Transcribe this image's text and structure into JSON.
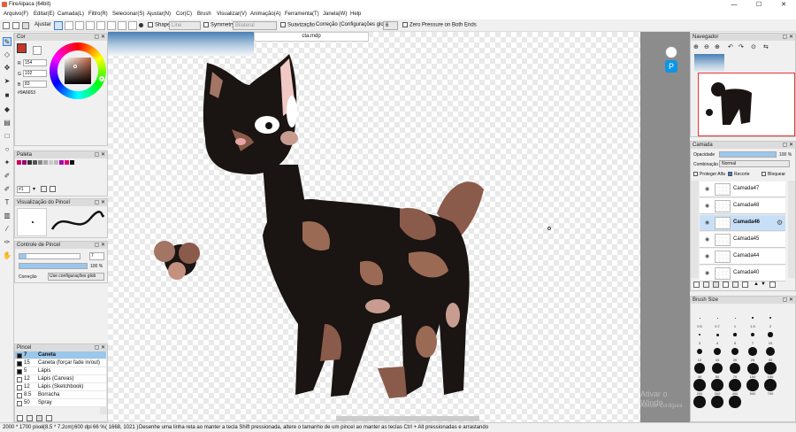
{
  "app": {
    "title": "FireAlpaca (64bit)",
    "window_controls": [
      "—",
      "☐",
      "✕"
    ]
  },
  "menu": [
    "Arquivo(F)",
    "Editar(E)",
    "Camada(L)",
    "Filtro(R)",
    "Selecionar(S)",
    "Ajustar(N)",
    "Cor(C)",
    "Brush",
    "Visualizar(V)",
    "Animação(A)",
    "Ferramenta(T)",
    "Janela(W)",
    "Help"
  ],
  "tool_options": {
    "ajustar": "Ajustar",
    "shape": "Shape",
    "shape_value": "Line",
    "symmetry": "Symmetry",
    "symmetry_value": "Bilateral",
    "suavizacao": "Suavização",
    "correcao": "Correção (Configurações globais)",
    "correcao_value": "6",
    "zero_pressure": "Zero Pressure on Both Ends"
  },
  "document_tab": "cta.mdp",
  "color_panel": {
    "title": "Cor",
    "r_label": "R",
    "r": "154",
    "g_label": "G",
    "g": "102",
    "b_label": "B",
    "b": "83",
    "hex": "#9A6653",
    "primary_color": "#9A6653"
  },
  "palette_panel": {
    "title": "Paleta",
    "page": "#1",
    "swatches": [
      "#c8005a",
      "#9b0070",
      "#333333",
      "#555555",
      "#888888",
      "#aaaaaa",
      "#cccccc",
      "#bbbbbb",
      "#aa00aa",
      "#e0006e",
      "#111111"
    ]
  },
  "brush_preview": {
    "title": "Visualização do Pincel"
  },
  "brush_control": {
    "title": "Controle de Pincel",
    "size": "7",
    "opacity": "100 %",
    "correction_label": "Correção",
    "correction_value": "Use configurações glob"
  },
  "brush_list": {
    "title": "Pincel",
    "items": [
      {
        "size": "7",
        "name": "Caneta",
        "active": true
      },
      {
        "size": "15",
        "name": "Caneta (forçar fade in/out)"
      },
      {
        "size": "5",
        "name": "Lápis"
      },
      {
        "size": "12",
        "name": "Lápis (Canvas)"
      },
      {
        "size": "12",
        "name": "Lápis (Sketchbook)"
      },
      {
        "size": "8.5",
        "name": "Borracha"
      },
      {
        "size": "50",
        "name": "Spray"
      }
    ]
  },
  "navigator": {
    "title": "Navegador"
  },
  "layer_panel": {
    "title": "Camada",
    "opacity_label": "Opacidade",
    "opacity": "100 %",
    "opacity_fraction": 1.0,
    "blend_label": "Combinação",
    "blend": "Normal",
    "protect_alpha": "Proteger Alfa",
    "clipping": "Recorte",
    "lock": "Bloquear",
    "layers": [
      "Camada47",
      "Camada48",
      "Camada46",
      "Camada45",
      "Camada44",
      "Camada40"
    ],
    "active_layer": "Camada46"
  },
  "brush_size": {
    "title": "Brush Size",
    "labels": [
      "0.5",
      "0.7",
      "1",
      "1.5",
      "2",
      "3",
      "4",
      "5",
      "7",
      "10",
      "12",
      "15",
      "20",
      "25",
      "30",
      "40",
      "50",
      "70",
      "100",
      "150",
      "200",
      "300",
      "400",
      "500",
      "700",
      "1000",
      "1500",
      "2000"
    ]
  },
  "status": {
    "dimensions": "2000 * 1700 pixel",
    "physical": "(8.5 * 7.2cm)",
    "dpi": "600 dpi",
    "zoom": "66 %",
    "coords": "( 1668, 1021 )",
    "hint": "Desenhe uma linha reta ao manter a tecla Shift pressionada, altere o tamanho de um pincel ao manter as teclas Ctrl + Alt pressionadas e arrastando"
  },
  "watermark": {
    "line1": "Ativar o Windo",
    "line2": "Acesse Configura"
  }
}
